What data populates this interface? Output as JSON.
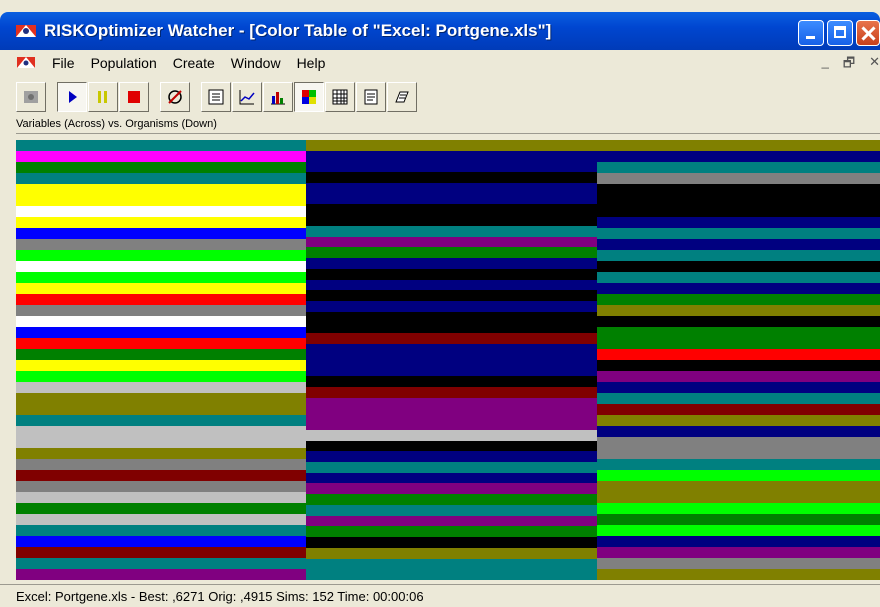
{
  "window": {
    "title": "RISKOptimizer Watcher - [Color Table of \"Excel: Portgene.xls\"]"
  },
  "menu": [
    "File",
    "Population",
    "Create",
    "Window",
    "Help"
  ],
  "toolbar": {
    "buttons": [
      "settings-icon",
      "play-icon",
      "pause-icon",
      "stop-icon",
      "diagnostics-icon",
      "log-icon",
      "line-graph-icon",
      "bar-graph-icon",
      "color-table-icon",
      "grid-table-icon",
      "summary-icon",
      "options-icon"
    ]
  },
  "view": {
    "caption": "Variables (Across) vs. Organisms (Down)"
  },
  "colors": {
    "teal": "#008080",
    "magenta": "#ff00ff",
    "green": "#008000",
    "lime": "#00ff00",
    "yellow": "#ffff00",
    "white": "#ffffff",
    "blue": "#0000ff",
    "gray": "#808080",
    "silver": "#c0c0c0",
    "red": "#ff0000",
    "navy": "#000080",
    "black": "#000000",
    "olive": "#808000",
    "purple": "#800080",
    "maroon": "#800000"
  },
  "color_table": [
    [
      [
        "teal",
        11
      ],
      [
        "magenta",
        11
      ],
      [
        "green",
        11
      ],
      [
        "teal",
        11
      ],
      [
        "yellow",
        22
      ],
      [
        "white",
        11
      ],
      [
        "yellow",
        11
      ],
      [
        "blue",
        11
      ],
      [
        "gray",
        11
      ],
      [
        "lime",
        11
      ],
      [
        "white",
        11
      ],
      [
        "lime",
        11
      ],
      [
        "yellow",
        11
      ],
      [
        "red",
        11
      ],
      [
        "gray",
        11
      ],
      [
        "white",
        11
      ],
      [
        "blue",
        11
      ],
      [
        "red",
        11
      ],
      [
        "green",
        11
      ],
      [
        "yellow",
        11
      ],
      [
        "lime",
        11
      ],
      [
        "silver",
        11
      ],
      [
        "olive",
        22
      ],
      [
        "teal",
        11
      ],
      [
        "silver",
        22
      ],
      [
        "olive",
        11
      ],
      [
        "gray",
        11
      ],
      [
        "maroon",
        11
      ],
      [
        "gray",
        11
      ],
      [
        "silver",
        11
      ],
      [
        "green",
        11
      ],
      [
        "silver",
        11
      ],
      [
        "teal",
        11
      ],
      [
        "blue",
        11
      ],
      [
        "maroon",
        11
      ],
      [
        "teal",
        11
      ],
      [
        "purple",
        11
      ]
    ],
    [
      [
        "olive",
        11
      ],
      [
        "navy",
        22
      ],
      [
        "black",
        11
      ],
      [
        "navy",
        22
      ],
      [
        "black",
        22
      ],
      [
        "teal",
        11
      ],
      [
        "purple",
        11
      ],
      [
        "green",
        11
      ],
      [
        "navy",
        11
      ],
      [
        "black",
        11
      ],
      [
        "navy",
        11
      ],
      [
        "black",
        11
      ],
      [
        "navy",
        11
      ],
      [
        "black",
        22
      ],
      [
        "maroon",
        11
      ],
      [
        "navy",
        33
      ],
      [
        "black",
        11
      ],
      [
        "maroon",
        11
      ],
      [
        "purple",
        33
      ],
      [
        "silver",
        11
      ],
      [
        "black",
        11
      ],
      [
        "navy",
        11
      ],
      [
        "teal",
        11
      ],
      [
        "navy",
        11
      ],
      [
        "purple",
        11
      ],
      [
        "green",
        11
      ],
      [
        "teal",
        11
      ],
      [
        "purple",
        11
      ],
      [
        "green",
        11
      ],
      [
        "black",
        11
      ],
      [
        "olive",
        11
      ],
      [
        "teal",
        22
      ]
    ],
    [
      [
        "olive",
        11
      ],
      [
        "navy",
        11
      ],
      [
        "teal",
        11
      ],
      [
        "gray",
        11
      ],
      [
        "black",
        33
      ],
      [
        "navy",
        11
      ],
      [
        "teal",
        11
      ],
      [
        "navy",
        11
      ],
      [
        "teal",
        11
      ],
      [
        "black",
        11
      ],
      [
        "teal",
        11
      ],
      [
        "navy",
        11
      ],
      [
        "green",
        11
      ],
      [
        "olive",
        11
      ],
      [
        "black",
        11
      ],
      [
        "green",
        22
      ],
      [
        "red",
        11
      ],
      [
        "black",
        11
      ],
      [
        "purple",
        11
      ],
      [
        "navy",
        11
      ],
      [
        "teal",
        11
      ],
      [
        "maroon",
        11
      ],
      [
        "olive",
        11
      ],
      [
        "navy",
        11
      ],
      [
        "gray",
        22
      ],
      [
        "teal",
        11
      ],
      [
        "lime",
        11
      ],
      [
        "olive",
        22
      ],
      [
        "lime",
        11
      ],
      [
        "green",
        11
      ],
      [
        "lime",
        11
      ],
      [
        "navy",
        11
      ],
      [
        "purple",
        11
      ],
      [
        "gray",
        11
      ],
      [
        "olive",
        11
      ]
    ]
  ],
  "status": {
    "text": "Excel: Portgene.xls - Best: ,6271  Orig: ,4915  Sims: 152 Time: 00:00:06"
  }
}
